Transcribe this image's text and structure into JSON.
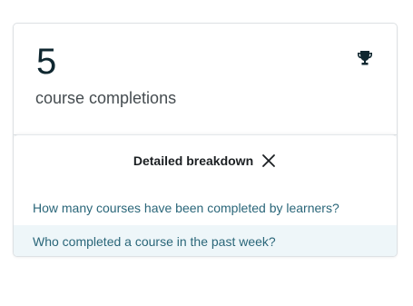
{
  "stat": {
    "value": "5",
    "label": "course completions",
    "icon": "trophy-icon"
  },
  "breakdown": {
    "title": "Detailed breakdown",
    "close_icon": "close-icon",
    "questions": [
      "How many courses have been completed by learners?",
      "Who completed a course in the past week?"
    ]
  },
  "colors": {
    "question_text": "#2a6679",
    "highlight_row": "#eef6f9"
  }
}
